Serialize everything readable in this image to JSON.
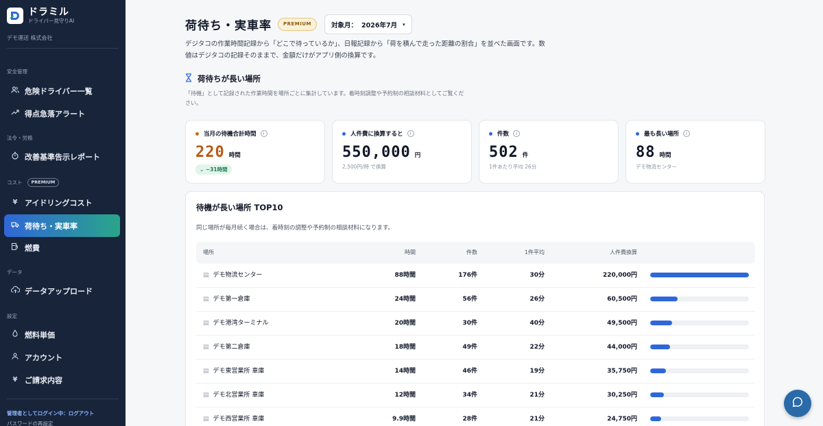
{
  "brand": {
    "name": "ドラミル",
    "subtitle": "ドライバー見守りAI",
    "logo_icon": "d-logo-icon"
  },
  "company": "デモ運送 株式会社",
  "sidebar": {
    "sections": [
      {
        "label": "安全管理"
      },
      {
        "label": "法令・労務"
      },
      {
        "label": "コスト",
        "badge": "PREMIUM"
      },
      {
        "label": "データ"
      },
      {
        "label": "設定"
      }
    ],
    "items": [
      {
        "label": "危険ドライバー一覧",
        "icon": "users-icon"
      },
      {
        "label": "得点急落アラート",
        "icon": "trend-icon"
      },
      {
        "label": "改善基準告示レポート",
        "icon": "stopwatch-icon"
      },
      {
        "label": "アイドリングコスト",
        "icon": "yen-icon"
      },
      {
        "label": "荷待ち・実車率",
        "icon": "truck-icon",
        "active": true
      },
      {
        "label": "燃費",
        "icon": "fuel-icon"
      },
      {
        "label": "データアップロード",
        "icon": "cloud-upload-icon"
      },
      {
        "label": "燃料単価",
        "icon": "drop-icon"
      },
      {
        "label": "アカウント",
        "icon": "user-icon"
      },
      {
        "label": "ご請求内容",
        "icon": "yen-icon"
      }
    ],
    "footer": {
      "login_status": "管理者としてログイン中：ログアウト",
      "reset_password": "パスワードの再設定"
    }
  },
  "header": {
    "title": "荷待ち・実車率",
    "badge": "PREMIUM",
    "month_label": "対象月：",
    "month_value": "2026年7月",
    "caret": "▾",
    "description": "デジタコの作業時間記録から「どこで待っているか」、日報記録から「荷を積んで走った距離の割合」を並べた画面です。数値はデジタコの記録そのままで、金額だけがアプリ側の換算です。"
  },
  "section": {
    "title": "荷待ちが長い場所",
    "description": "「待機」として記録された作業時間を場所ごとに集計しています。着時刻調整や予約制の相談材料としてご覧ください。"
  },
  "cards": [
    {
      "label": "当月の待機合計時間",
      "value": "220",
      "unit": "時間",
      "delta": "⌄ −31時間",
      "dot_color": "#c8691c",
      "value_color": "#b85a14"
    },
    {
      "label": "人件費に換算すると",
      "value": "550,000",
      "unit": "円",
      "sub": "2,500円/時 で換算",
      "dot_color": "#2f67d8",
      "value_color": "#111827"
    },
    {
      "label": "件数",
      "value": "502",
      "unit": "件",
      "sub": "1件あたり平均 26分",
      "dot_color": "#2f67d8",
      "value_color": "#111827"
    },
    {
      "label": "最も長い場所",
      "value": "88",
      "unit": "時間",
      "sub": "デモ物流センター",
      "dot_color": "#2f67d8",
      "value_color": "#111827"
    }
  ],
  "table": {
    "title": "待機が長い場所 TOP10",
    "description": "同じ場所が毎月続く場合は、着時刻の調整や予約制の相談材料になります。",
    "headers": {
      "place": "場所",
      "hours": "時間",
      "count": "件数",
      "avg": "1件平均",
      "cost": "人件費換算"
    },
    "rows": [
      {
        "place": "デモ物流センター",
        "hours": "88時間",
        "count": "176件",
        "avg": "30分",
        "cost": "220,000円",
        "share": 1.0
      },
      {
        "place": "デモ第一倉庫",
        "hours": "24時間",
        "count": "56件",
        "avg": "26分",
        "cost": "60,500円",
        "share": 0.275
      },
      {
        "place": "デモ港湾ターミナル",
        "hours": "20時間",
        "count": "30件",
        "avg": "40分",
        "cost": "49,500円",
        "share": 0.225
      },
      {
        "place": "デモ第二倉庫",
        "hours": "18時間",
        "count": "49件",
        "avg": "22分",
        "cost": "44,000円",
        "share": 0.2
      },
      {
        "place": "デモ東営業所 車庫",
        "hours": "14時間",
        "count": "46件",
        "avg": "19分",
        "cost": "35,750円",
        "share": 0.1625
      },
      {
        "place": "デモ北営業所 車庫",
        "hours": "12時間",
        "count": "34件",
        "avg": "21分",
        "cost": "30,250円",
        "share": 0.1375
      },
      {
        "place": "デモ西営業所 車庫",
        "hours": "9.9時間",
        "count": "28件",
        "avg": "21分",
        "cost": "24,750円",
        "share": 0.1125
      }
    ]
  },
  "chat_icon": "chat-bubble-icon",
  "colors": {
    "accent": "#2f67d8",
    "sidebar_bg": "#17243a",
    "premium": "#e8c77a",
    "positive": "#1f7a53"
  }
}
